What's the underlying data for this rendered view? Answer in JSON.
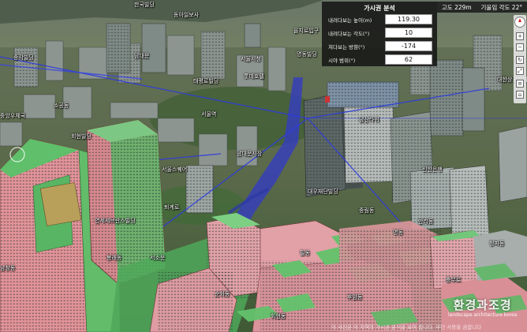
{
  "analysis_panel": {
    "title": "가시권 분석",
    "fields": [
      {
        "label": "내려다보는 높이(m)",
        "value": "119.30"
      },
      {
        "label": "내려다보는 각도(°)",
        "value": "10"
      },
      {
        "label": "쳐다보는 방향(°)",
        "value": "-174"
      },
      {
        "label": "시야 범위(°)",
        "value": "62"
      }
    ]
  },
  "status_bar": {
    "altitude": "고도 229m",
    "tilt": "기울임 각도 22°"
  },
  "map_labels": {
    "l1": "한국빌딩",
    "l2": "동아일보사",
    "l3": "을지로입구",
    "l4": "종각빌딩",
    "l5": "남대문",
    "l6": "서울시청",
    "l7": "명동빌딩",
    "l8": "태평로빌딩",
    "l9": "롯데호텔",
    "l10": "소공동",
    "l11": "서울역",
    "l12": "중앙우체국",
    "l13": "남산타워",
    "l14": "대한상공회의소",
    "l15": "회현빌딩",
    "l16": "남대문시장",
    "l17": "신한은행",
    "l18": "서울스퀘어",
    "l19": "대우재단빌딩",
    "l20": "연세세브란스빌딩",
    "l21": "퇴계로",
    "l22": "남창동",
    "l23": "봉래동",
    "l24": "서소문",
    "l25": "순화동",
    "l26": "중림동",
    "l27": "만리동",
    "l28": "청파동",
    "l29": "후암동",
    "l30": "회현동",
    "l31": "명동",
    "l32": "충무로",
    "l33": "필동"
  },
  "watermark": {
    "title": "환경과조경",
    "subtitle": "landscape architecture korea"
  },
  "footer_text": "이 사진은 이 지역의 가시권 분석을 보여 줍니다. 무단 사용을 금합니다"
}
